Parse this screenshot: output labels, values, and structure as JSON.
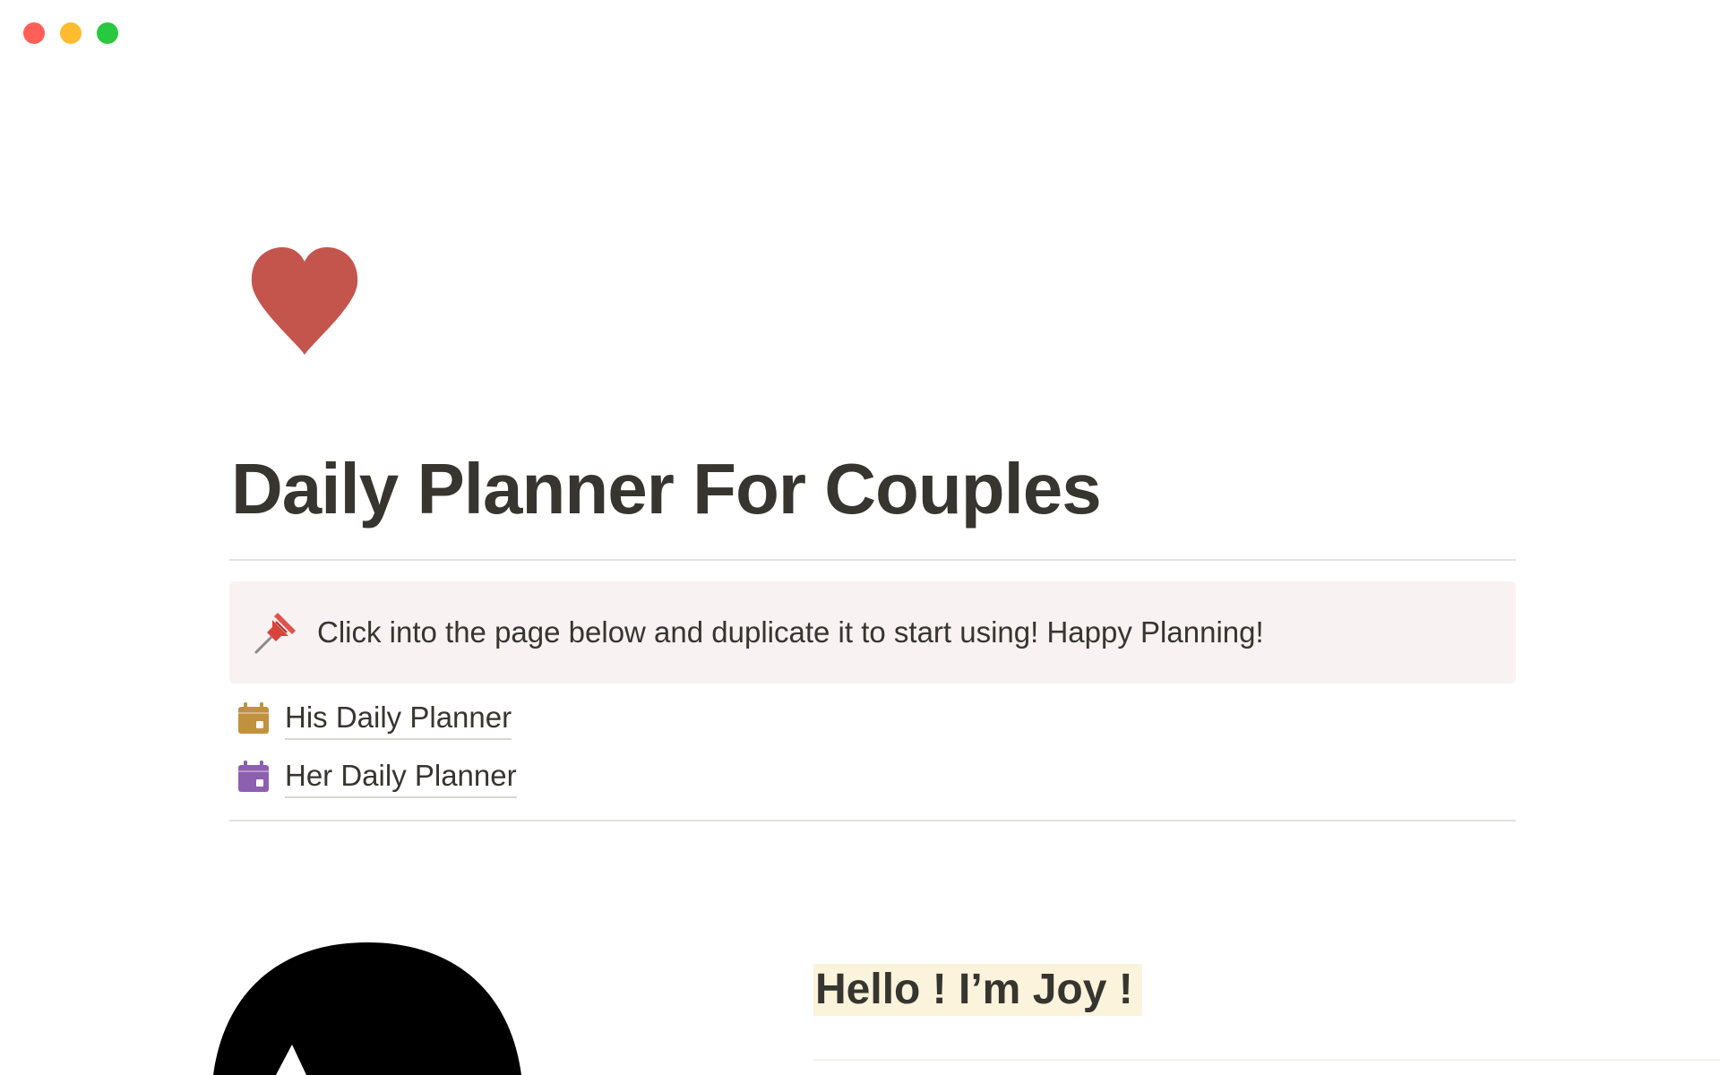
{
  "window": {
    "controls": [
      "close",
      "minimize",
      "zoom"
    ]
  },
  "page": {
    "icon": "heart-icon",
    "icon_color": "#c4554d",
    "title": "Daily Planner For Couples"
  },
  "callout": {
    "icon": "pushpin-icon",
    "text": "Click into the page below and duplicate it to start using! Happy Planning!",
    "background": "#f8f2f2"
  },
  "links": [
    {
      "icon": "calendar-icon",
      "icon_color": "#c2913f",
      "label": "His Daily Planner"
    },
    {
      "icon": "calendar-icon",
      "icon_color": "#8d5fb0",
      "label": "Her Daily Planner"
    }
  ],
  "intro": {
    "avatar": "avatar-image",
    "heading": "Hello ! I’m Joy !",
    "highlight": "#fbf3db"
  }
}
